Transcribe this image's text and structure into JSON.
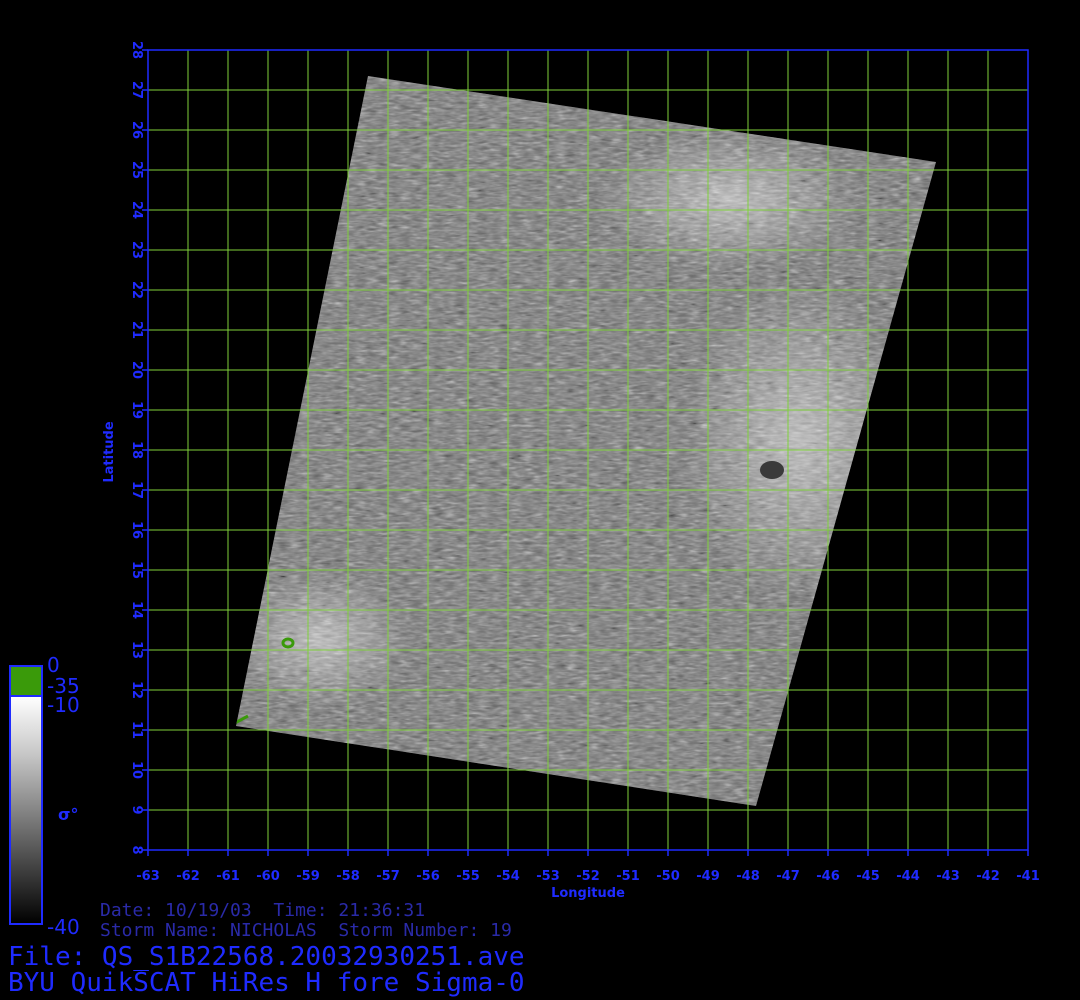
{
  "map": {
    "type": "sigma0-swath-map",
    "lon_range": [
      -63,
      -41
    ],
    "lat_range": [
      8,
      28
    ],
    "lon_ticks": [
      "-63",
      "-62",
      "-61",
      "-60",
      "-59",
      "-58",
      "-57",
      "-56",
      "-55",
      "-54",
      "-53",
      "-52",
      "-51",
      "-50",
      "-49",
      "-48",
      "-47",
      "-46",
      "-45",
      "-44",
      "-43",
      "-42",
      "-41"
    ],
    "lat_ticks": [
      "8",
      "9",
      "10",
      "11",
      "12",
      "13",
      "14",
      "15",
      "16",
      "17",
      "18",
      "19",
      "20",
      "21",
      "22",
      "23",
      "24",
      "25",
      "26",
      "27",
      "28"
    ],
    "xlabel": "Longitude",
    "ylabel": "Latitude",
    "grid": true,
    "grid_color": "#7fd13a",
    "axis_color": "#1f2bff",
    "swath_corners_lonlat": [
      [
        -57.5,
        27.35
      ],
      [
        -43.3,
        25.2
      ],
      [
        -47.8,
        9.1
      ],
      [
        -60.8,
        11.1
      ]
    ]
  },
  "colorbar": {
    "labels": [
      "0",
      "-35",
      "-10",
      "-40"
    ],
    "symbol": "σ°",
    "colors": [
      "#3a9a0a",
      "#ffffff",
      "#000000"
    ]
  },
  "info": {
    "date_line": "Date: 10/19/03  Time: 21:36:31",
    "storm_line": "Storm Name: NICHOLAS  Storm Number: 19",
    "file_line": "File: QS_S1B22568.20032930251.ave",
    "title_line": "BYU QuikSCAT HiRes H fore Sigma-0"
  }
}
